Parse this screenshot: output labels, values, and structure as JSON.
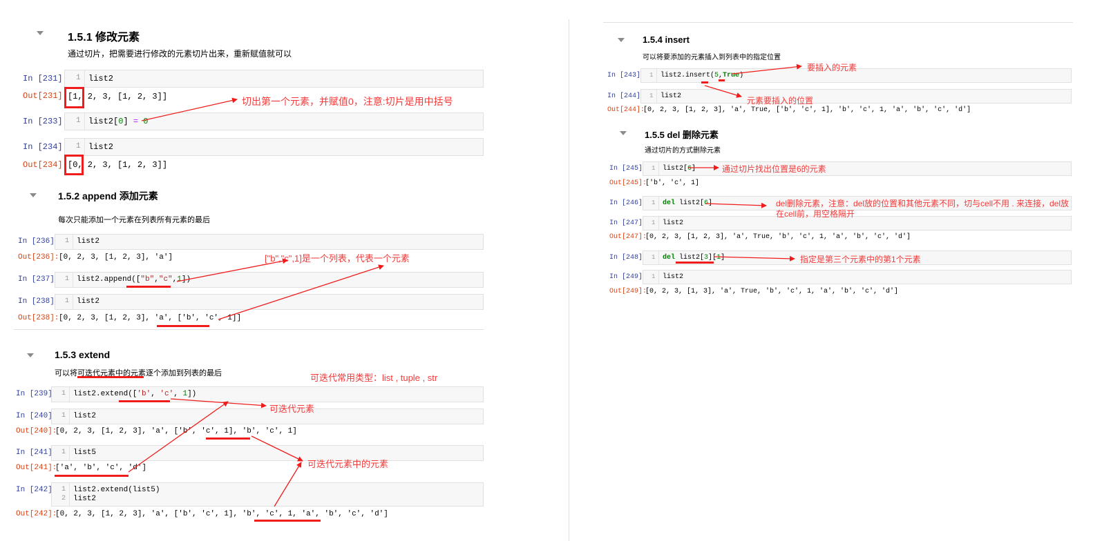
{
  "left": {
    "s151": {
      "title": "1.5.1  修改元素",
      "desc": "通过切片，把需要进行修改的元素切片出来，重新赋值就可以",
      "cells": [
        {
          "in": "In [231]:",
          "line": "1",
          "code": "list2",
          "out_label": "Out[231]:",
          "output": "[1, 2, 3, [1, 2, 3]]"
        },
        {
          "in": "In [233]:",
          "line": "1",
          "code_a": "list2[",
          "code_b": "0",
          "code_c": "] ",
          "code_d": "=",
          "code_e": " ",
          "code_f": "0"
        },
        {
          "in": "In [234]:",
          "line": "1",
          "code": "list2",
          "out_label": "Out[234]:",
          "output": "[0, 2, 3, [1, 2, 3]]"
        }
      ],
      "annotation": "切出第一个元素，并赋值0，注意:切片是用中括号"
    },
    "s152": {
      "title": "1.5.2  append 添加元素",
      "desc": "每次只能添加一个元素在列表所有元素的最后",
      "cells": [
        {
          "in": "In [236]:",
          "line": "1",
          "code": "list2",
          "out_label": "Out[236]:",
          "output": "[0, 2, 3, [1, 2, 3], 'a']"
        },
        {
          "in": "In [237]:",
          "line": "1",
          "code_a": "list2.append([",
          "code_b": "\"b\"",
          "code_c": ",",
          "code_d": "\"c\"",
          "code_e": ",",
          "code_f": "1",
          "code_g": "])"
        },
        {
          "in": "In [238]:",
          "line": "1",
          "code": "list2",
          "out_label": "Out[238]:",
          "output": "[0, 2, 3, [1, 2, 3], 'a', ['b', 'c', 1]]"
        }
      ],
      "annotation": "[\"b\",\"c\",1]是一个列表，代表一个元素"
    },
    "s153": {
      "title": "1.5.3  extend",
      "desc": "可以将可迭代元素中的元素逐个添加到列表的最后",
      "annotation_types": "可迭代常用类型：list , tuple , str",
      "annotation_iter": "可迭代元素",
      "annotation_iter_elems": "可迭代元素中的元素",
      "cells": [
        {
          "in": "In [239]:",
          "line": "1",
          "code_a": "list2.extend([",
          "code_b": "'b'",
          "code_c": ", ",
          "code_d": "'c'",
          "code_e": ", ",
          "code_f": "1",
          "code_g": "])"
        },
        {
          "in": "In [240]:",
          "line": "1",
          "code": "list2",
          "out_label": "Out[240]:",
          "output": "[0, 2, 3, [1, 2, 3], 'a', ['b', 'c', 1], 'b', 'c', 1]"
        },
        {
          "in": "In [241]:",
          "line": "1",
          "code": "list5",
          "out_label": "Out[241]:",
          "output": "['a', 'b', 'c', 'd']"
        },
        {
          "in": "In [242]:",
          "line1": "1",
          "line2": "2",
          "code1": "list2.extend(list5)",
          "code2": "list2",
          "out_label": "Out[242]:",
          "output": "[0, 2, 3, [1, 2, 3], 'a', ['b', 'c', 1], 'b', 'c', 1, 'a', 'b', 'c', 'd']"
        }
      ]
    }
  },
  "right": {
    "s154": {
      "title": "1.5.4  insert",
      "desc": "可以将要添加的元素插入到列表中的指定位置",
      "cells": [
        {
          "in": "In [243]:",
          "line": "1",
          "code_a": "list2.insert(",
          "code_b": "5",
          "code_c": ",",
          "code_d": "True",
          "code_e": ")"
        },
        {
          "in": "In [244]:",
          "line": "1",
          "code": "list2",
          "out_label": "Out[244]:",
          "output": "[0, 2, 3, [1, 2, 3], 'a', True, ['b', 'c', 1], 'b', 'c', 1, 'a', 'b', 'c', 'd']"
        }
      ],
      "annotation_elem": "要插入的元素",
      "annotation_pos": "元素要插入的位置"
    },
    "s155": {
      "title": "1.5.5  del 删除元素",
      "desc": "通过切片的方式删除元素",
      "cells": [
        {
          "in": "In [245]:",
          "line": "1",
          "code_a": "list2[",
          "code_b": "6",
          "code_c": "]",
          "out_label": "Out[245]:",
          "output": "['b', 'c', 1]"
        },
        {
          "in": "In [246]:",
          "line": "1",
          "code_kw": "del",
          "code_a": " list2[",
          "code_b": "6",
          "code_c": "]"
        },
        {
          "in": "In [247]:",
          "line": "1",
          "code": "list2",
          "out_label": "Out[247]:",
          "output": "[0, 2, 3, [1, 2, 3], 'a', True, 'b', 'c', 1, 'a', 'b', 'c', 'd']"
        },
        {
          "in": "In [248]:",
          "line": "1",
          "code_kw": "del",
          "code_a": " list2[",
          "code_b": "3",
          "code_c": "][",
          "code_d": "1",
          "code_e": "]"
        },
        {
          "in": "In [249]:",
          "line": "1",
          "code": "list2",
          "out_label": "Out[249]:",
          "output": "[0, 2, 3, [1, 3], 'a', True, 'b', 'c', 1, 'a', 'b', 'c', 'd']"
        }
      ],
      "annotation_find": "通过切片找出位置是6的元素",
      "annotation_del_1": "del删除元素，注意：del放的位置和其他元素不同，切与cell不用 . 来连接，del放",
      "annotation_del_2": "在cell前，用空格隔开",
      "annotation_nested": "指定是第三个元素中的第1个元素"
    }
  },
  "colors": {
    "annotation": "#f23a3a",
    "in_prompt": "#303f9f",
    "out_prompt": "#d84315",
    "cell_bg": "#f7f7f7"
  },
  "icons": [
    "collapse-caret-icon"
  ]
}
